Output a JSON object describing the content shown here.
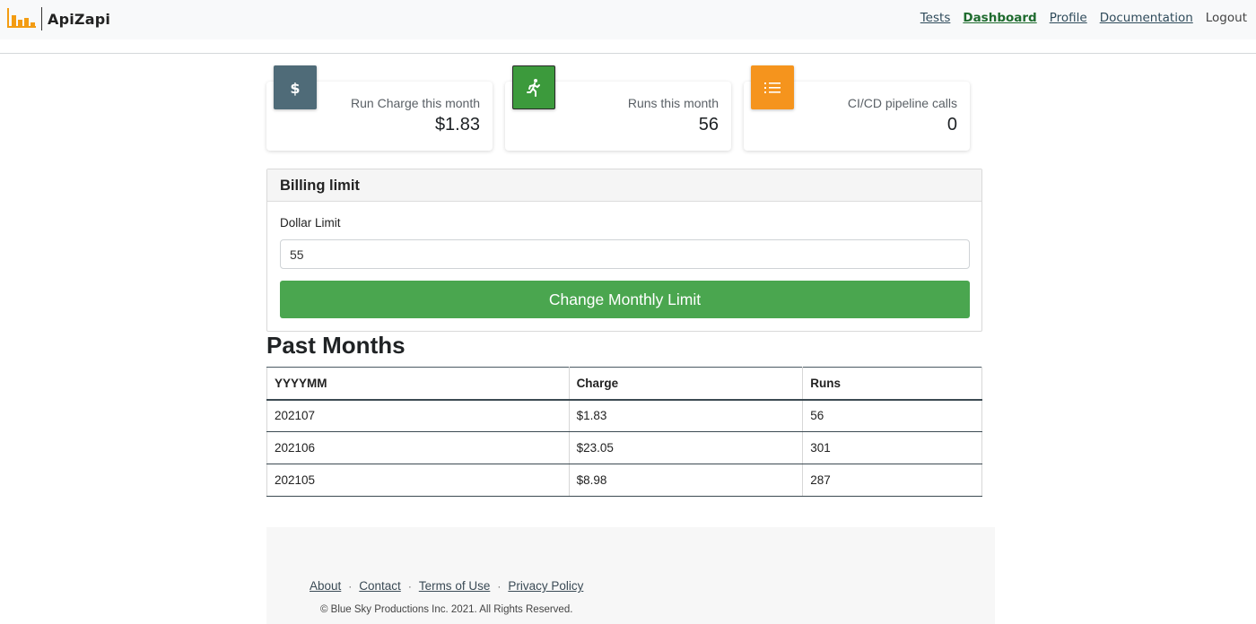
{
  "brand": {
    "name": "ApiZapi",
    "color": "#f39c12"
  },
  "nav": {
    "items": [
      "Tests",
      "Dashboard",
      "Profile",
      "Documentation",
      "Logout"
    ],
    "active": "Dashboard"
  },
  "stats": [
    {
      "icon": "dollar-icon",
      "color": "#4f6b78",
      "label": "Run Charge this month",
      "value": "$1.83"
    },
    {
      "icon": "running-person-icon",
      "color": "#3c9a3c",
      "label": "Runs this month",
      "value": "56"
    },
    {
      "icon": "list-icon",
      "color": "#f5941d",
      "label": "CI/CD pipeline calls",
      "value": "0"
    }
  ],
  "billing": {
    "title": "Billing limit",
    "field_label": "Dollar Limit",
    "value": "55",
    "button_label": "Change Monthly Limit",
    "button_color": "#4aa64f"
  },
  "past_months": {
    "title": "Past Months",
    "columns": [
      "YYYYMM",
      "Charge",
      "Runs"
    ],
    "rows": [
      [
        "202107",
        "$1.83",
        "56"
      ],
      [
        "202106",
        "$23.05",
        "301"
      ],
      [
        "202105",
        "$8.98",
        "287"
      ]
    ]
  },
  "footer": {
    "links": [
      "About",
      "Contact",
      "Terms of Use",
      "Privacy Policy"
    ],
    "separator": "·",
    "copyright": "© Blue Sky Productions Inc. 2021. All Rights Reserved."
  }
}
